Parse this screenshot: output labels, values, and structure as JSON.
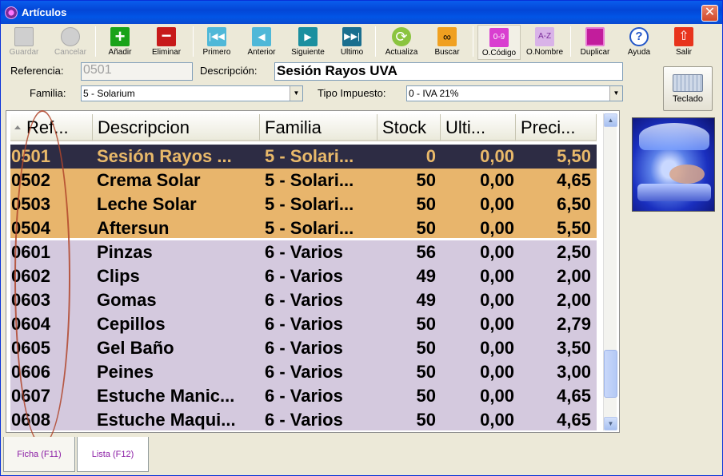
{
  "window": {
    "title": "Artículos"
  },
  "toolbar": {
    "guardar": "Guardar",
    "cancelar": "Cancelar",
    "anadir": "Añadir",
    "eliminar": "Eliminar",
    "primero": "Primero",
    "anterior": "Anterior",
    "siguiente": "Siguiente",
    "ultimo": "Ultimo",
    "actualiza": "Actualiza",
    "buscar": "Buscar",
    "ocodigo": "O.Código",
    "onombre": "O.Nombre",
    "duplicar": "Duplicar",
    "ayuda": "Ayuda",
    "salir": "Salir"
  },
  "form": {
    "referencia_label": "Referencia:",
    "referencia_value": "0501",
    "descripcion_label": "Descripción:",
    "descripcion_value": "Sesión Rayos UVA",
    "familia_label": "Familia:",
    "familia_value": "5 - Solarium",
    "tipo_impuesto_label": "Tipo Impuesto:",
    "tipo_impuesto_value": "0 - IVA 21%"
  },
  "teclado": "Teclado",
  "grid": {
    "headers": [
      "Ref...",
      "Descripcion",
      "Familia",
      "Stock",
      "Ulti...",
      "Preci..."
    ],
    "rows": [
      [
        "0501",
        "Sesión Rayos ...",
        "5 - Solari...",
        "0",
        "0,00",
        "5,50"
      ],
      [
        "0502",
        "Crema Solar",
        "5 - Solari...",
        "50",
        "0,00",
        "4,65"
      ],
      [
        "0503",
        "Leche Solar",
        "5 - Solari...",
        "50",
        "0,00",
        "6,50"
      ],
      [
        "0504",
        "Aftersun",
        "5 - Solari...",
        "50",
        "0,00",
        "5,50"
      ],
      [
        "0601",
        "Pinzas",
        "6 - Varios",
        "56",
        "0,00",
        "2,50"
      ],
      [
        "0602",
        "Clips",
        "6 - Varios",
        "49",
        "0,00",
        "2,00"
      ],
      [
        "0603",
        "Gomas",
        "6 - Varios",
        "49",
        "0,00",
        "2,00"
      ],
      [
        "0604",
        "Cepillos",
        "6 - Varios",
        "50",
        "0,00",
        "2,79"
      ],
      [
        "0605",
        "Gel Baño",
        "6 - Varios",
        "50",
        "0,00",
        "3,50"
      ],
      [
        "0606",
        "Peines",
        "6 - Varios",
        "50",
        "0,00",
        "3,00"
      ],
      [
        "0607",
        "Estuche Manic...",
        "6 - Varios",
        "50",
        "0,00",
        "4,65"
      ],
      [
        "0608",
        "Estuche Maqui...",
        "6 - Varios",
        "50",
        "0,00",
        "4,65"
      ]
    ]
  },
  "tabs": [
    "Ficha (F11)",
    "Lista (F12)"
  ],
  "colors": {
    "selected_row": "#2d2c44",
    "selected_text": "#e9b96a",
    "solarium_row": "#e8b56c",
    "varios_row": "#d4c9de",
    "annotation": "#b0452a"
  }
}
